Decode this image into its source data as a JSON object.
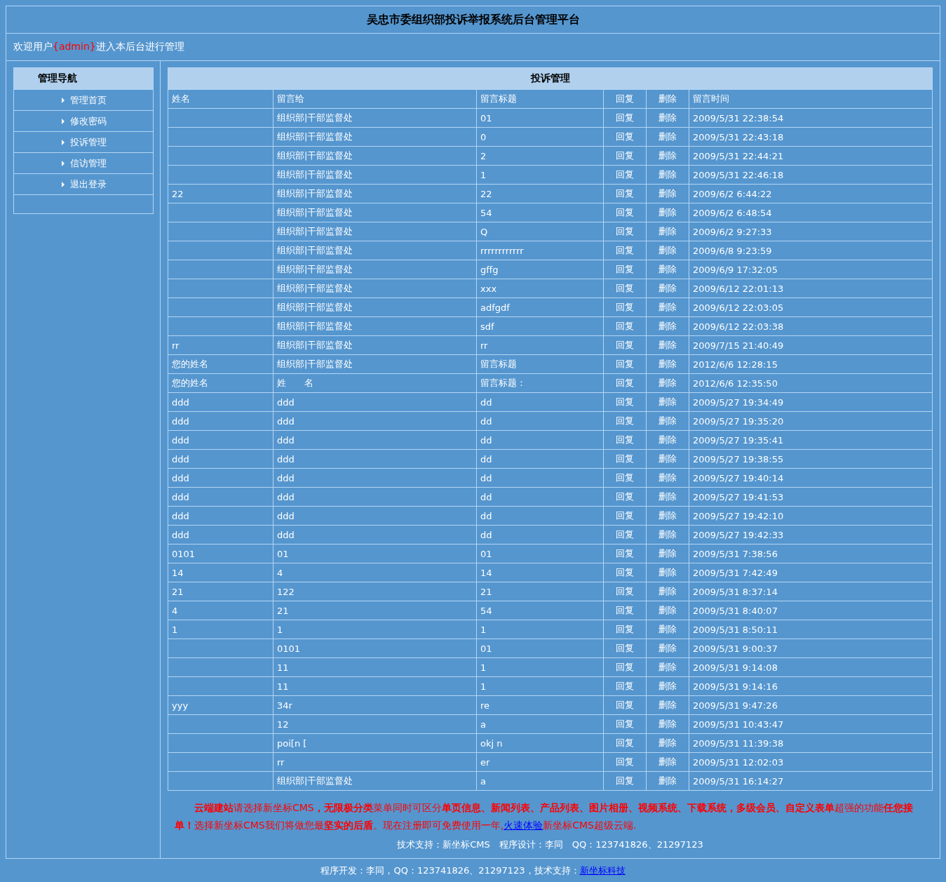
{
  "header": {
    "title": "吴忠市委组织部投诉举报系统后台管理平台"
  },
  "welcome": {
    "prefix": "欢迎用户",
    "user": "{admin}",
    "suffix": "进入本后台进行管理"
  },
  "sidebar": {
    "title": "管理导航",
    "items": [
      "管理首页",
      "修改密码",
      "投诉管理",
      "信访管理",
      "退出登录"
    ]
  },
  "table": {
    "title": "投诉管理",
    "columns": [
      "姓名",
      "留言给",
      "留言标题",
      "回复",
      "删除",
      "留言时间"
    ],
    "rows": [
      {
        "to": "组织部|干部监督处",
        "subject": "01",
        "reply": "回复",
        "delete": "删除",
        "time": "2009/5/31 22:38:54"
      },
      {
        "to": "组织部|干部监督处",
        "subject": "0",
        "reply": "回复",
        "delete": "删除",
        "time": "2009/5/31 22:43:18"
      },
      {
        "to": "组织部|干部监督处",
        "subject": "2",
        "reply": "回复",
        "delete": "删除",
        "time": "2009/5/31 22:44:21"
      },
      {
        "to": "组织部|干部监督处",
        "subject": "1",
        "reply": "回复",
        "delete": "删除",
        "time": "2009/5/31 22:46:18"
      },
      {
        "name": "22",
        "to": "组织部|干部监督处",
        "subject": "22",
        "reply": "回复",
        "delete": "删除",
        "time": "2009/6/2 6:44:22"
      },
      {
        "to": "组织部|干部监督处",
        "subject": "54",
        "reply": "回复",
        "delete": "删除",
        "time": "2009/6/2 6:48:54"
      },
      {
        "to": "组织部|干部监督处",
        "subject": "Q",
        "reply": "回复",
        "delete": "删除",
        "time": "2009/6/2 9:27:33"
      },
      {
        "to": "组织部|干部监督处",
        "subject": "rrrrrrrrrrrr",
        "reply": "回复",
        "delete": "删除",
        "time": "2009/6/8 9:23:59"
      },
      {
        "to": "组织部|干部监督处",
        "subject": "gffg",
        "reply": "回复",
        "delete": "删除",
        "time": "2009/6/9 17:32:05"
      },
      {
        "to": "组织部|干部监督处",
        "subject": "xxx",
        "reply": "回复",
        "delete": "删除",
        "time": "2009/6/12 22:01:13"
      },
      {
        "to": "组织部|干部监督处",
        "subject": "adfgdf",
        "reply": "回复",
        "delete": "删除",
        "time": "2009/6/12 22:03:05"
      },
      {
        "to": "组织部|干部监督处",
        "subject": "sdf",
        "reply": "回复",
        "delete": "删除",
        "time": "2009/6/12 22:03:38"
      },
      {
        "name": "rr",
        "to": "组织部|干部监督处",
        "subject": "rr",
        "reply": "回复",
        "delete": "删除",
        "time": "2009/7/15 21:40:49"
      },
      {
        "name": "您的姓名",
        "to": "组织部|干部监督处",
        "subject": "留言标题",
        "reply": "回复",
        "delete": "删除",
        "time": "2012/6/6 12:28:15"
      },
      {
        "name": "您的姓名",
        "to": "姓　　名",
        "subject": "留言标题：",
        "reply": "回复",
        "delete": "删除",
        "time": "2012/6/6 12:35:50"
      },
      {
        "name": "ddd",
        "to": "ddd",
        "subject": "dd",
        "reply": "回复",
        "delete": "删除",
        "time": "2009/5/27 19:34:49"
      },
      {
        "name": "ddd",
        "to": "ddd",
        "subject": "dd",
        "reply": "回复",
        "delete": "删除",
        "time": "2009/5/27 19:35:20"
      },
      {
        "name": "ddd",
        "to": "ddd",
        "subject": "dd",
        "reply": "回复",
        "delete": "删除",
        "time": "2009/5/27 19:35:41"
      },
      {
        "name": "ddd",
        "to": "ddd",
        "subject": "dd",
        "reply": "回复",
        "delete": "删除",
        "time": "2009/5/27 19:38:55"
      },
      {
        "name": "ddd",
        "to": "ddd",
        "subject": "dd",
        "reply": "回复",
        "delete": "删除",
        "time": "2009/5/27 19:40:14"
      },
      {
        "name": "ddd",
        "to": "ddd",
        "subject": "dd",
        "reply": "回复",
        "delete": "删除",
        "time": "2009/5/27 19:41:53"
      },
      {
        "name": "ddd",
        "to": "ddd",
        "subject": "dd",
        "reply": "回复",
        "delete": "删除",
        "time": "2009/5/27 19:42:10"
      },
      {
        "name": "ddd",
        "to": "ddd",
        "subject": "dd",
        "reply": "回复",
        "delete": "删除",
        "time": "2009/5/27 19:42:33"
      },
      {
        "name": "0101",
        "to": "01",
        "subject": "01",
        "reply": "回复",
        "delete": "删除",
        "time": "2009/5/31 7:38:56"
      },
      {
        "name": "14",
        "to": "4",
        "subject": "14",
        "reply": "回复",
        "delete": "删除",
        "time": "2009/5/31 7:42:49"
      },
      {
        "name": "21",
        "to": "122",
        "subject": "21",
        "reply": "回复",
        "delete": "删除",
        "time": "2009/5/31 8:37:14"
      },
      {
        "name": "4",
        "to": "21",
        "subject": "54",
        "reply": "回复",
        "delete": "删除",
        "time": "2009/5/31 8:40:07"
      },
      {
        "name": "1",
        "to": "1",
        "subject": "1",
        "reply": "回复",
        "delete": "删除",
        "time": "2009/5/31 8:50:11"
      },
      {
        "to": "0101",
        "subject": "01",
        "reply": "回复",
        "delete": "删除",
        "time": "2009/5/31 9:00:37"
      },
      {
        "to": "11",
        "subject": "1",
        "reply": "回复",
        "delete": "删除",
        "time": "2009/5/31 9:14:08"
      },
      {
        "to": "11",
        "subject": "1",
        "reply": "回复",
        "delete": "删除",
        "time": "2009/5/31 9:14:16"
      },
      {
        "name": "yyy",
        "to": "34r",
        "subject": "re",
        "reply": "回复",
        "delete": "删除",
        "time": "2009/5/31 9:47:26"
      },
      {
        "to": "12",
        "subject": "a",
        "reply": "回复",
        "delete": "删除",
        "time": "2009/5/31 10:43:47"
      },
      {
        "to": "poi[n [",
        "subject": "okj n",
        "reply": "回复",
        "delete": "删除",
        "time": "2009/5/31 11:39:38"
      },
      {
        "to": "rr",
        "subject": "er",
        "reply": "回复",
        "delete": "删除",
        "time": "2009/5/31 12:02:03"
      },
      {
        "to": "组织部|干部监督处",
        "subject": "a",
        "reply": "回复",
        "delete": "删除",
        "time": "2009/5/31 16:14:27"
      }
    ]
  },
  "promo": {
    "before": "**云端建站**请选择新坐标CMS**，无限极分类**菜单同时可区分**单页信息、新闻列表、产品列表、图片相册、视频系统、下载系统，多级会员、自定义表单**超强的功能**任您接单！**选择新坐标CMS我们将做您最**坚实的后盾**。现在注册即可免费使用一年,",
    "link": "火速体验",
    "after": "新坐标CMS超级云端."
  },
  "credits": "技术支持：新坐标CMS　程序设计：李同　QQ：123741826、21297123",
  "footer": {
    "text": "程序开发：李同，QQ：123741826、21297123，技术支持：",
    "link": "新坐标科技"
  }
}
